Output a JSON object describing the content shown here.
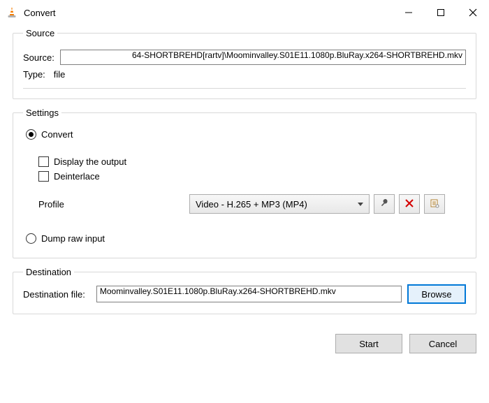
{
  "window": {
    "title": "Convert"
  },
  "source": {
    "legend": "Source",
    "source_label": "Source:",
    "source_value": "64-SHORTBREHD[rartv]\\Moominvalley.S01E11.1080p.BluRay.x264-SHORTBREHD.mkv",
    "type_label": "Type:",
    "type_value": "file"
  },
  "settings": {
    "legend": "Settings",
    "convert_label": "Convert",
    "display_output_label": "Display the output",
    "deinterlace_label": "Deinterlace",
    "profile_label": "Profile",
    "profile_value": "Video - H.265 + MP3 (MP4)",
    "dump_raw_label": "Dump raw input"
  },
  "destination": {
    "legend": "Destination",
    "file_label": "Destination file:",
    "file_value": "Moominvalley.S01E11.1080p.BluRay.x264-SHORTBREHD.mkv",
    "browse_label": "Browse"
  },
  "footer": {
    "start_label": "Start",
    "cancel_label": "Cancel"
  }
}
